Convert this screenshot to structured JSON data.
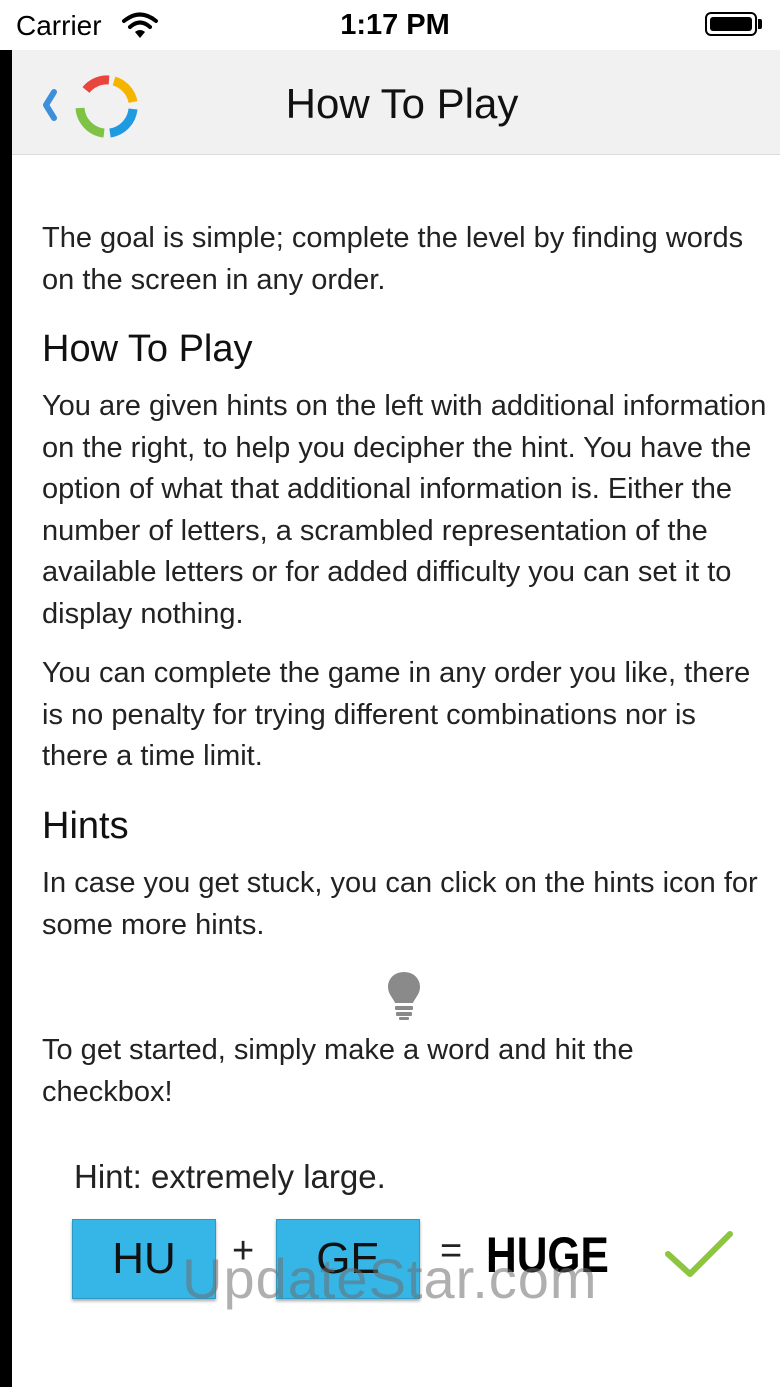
{
  "status_bar": {
    "carrier": "Carrier",
    "time": "1:17 PM"
  },
  "nav": {
    "title": "How To Play",
    "back_icon": "chevron-left-icon",
    "logo_icon": "colored-ring-logo",
    "logo_colors": [
      "#e8453c",
      "#f5b400",
      "#1e9be0",
      "#7ec343"
    ]
  },
  "content": {
    "intro": "The goal is simple; complete the level by finding words on the screen in any order.",
    "how_to_play_heading": "How To Play",
    "how_to_play_text": "You are given hints on the left with additional information on the right, to help you decipher the hint. You have the option of what that additional information is. Either the number of letters, a scrambled representation of the available letters or for added difficulty you can set it to display nothing.",
    "order_text": "You can complete the game in any order you like, there is no penalty for trying different combinations nor is there a time limit.",
    "hints_heading": "Hints",
    "hints_text": "In case you get stuck, you can click on the hints icon for some more hints.",
    "hints_icon": "lightbulb-icon",
    "start_text": "To get started, simply make a word and hit the checkbox!"
  },
  "example": {
    "hint": "Hint: extremely large.",
    "tile_1": "HU",
    "plus": "+",
    "tile_2": "GE",
    "equals": "=",
    "result": "HUGE",
    "check_icon": "checkmark-icon",
    "tile_color": "#35b6e6",
    "check_color": "#8cc63f"
  },
  "watermark": "UpdateStar.com"
}
